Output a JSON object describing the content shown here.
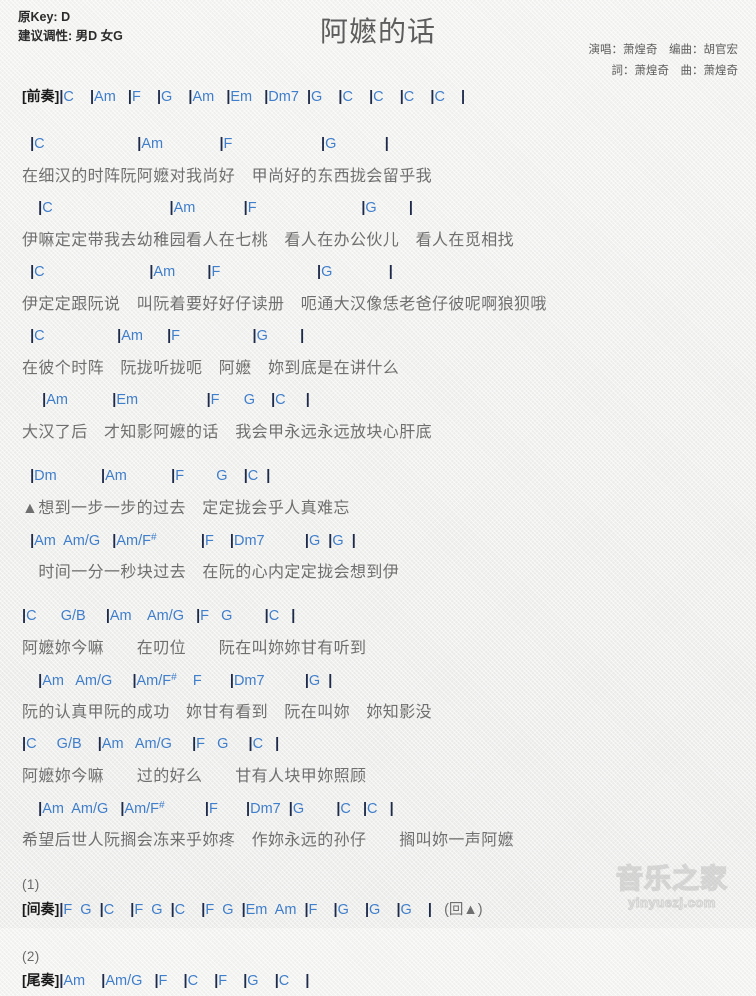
{
  "header": {
    "orig_key": "原Key: D",
    "suggested_key": "建议调性: 男D 女G",
    "title": "阿嬷的话",
    "credit_line_1": "演唱：萧煌奇　编曲：胡官宏",
    "credit_line_2": "詞：萧煌奇　曲：萧煌奇"
  },
  "labels": {
    "intro": "[前奏]",
    "interlude": "[间奏]",
    "outro": "[尾奏]",
    "repeat_mark": "(回▲)",
    "num_1": "(1)",
    "num_2": "(2)",
    "triangle": "▲"
  },
  "intro": {
    "chords": "|C    |Am   |F    |G    |Am   |Em   |Dm7  |G    |C    |C    |C    |C    |"
  },
  "verse1": [
    {
      "chords": "  |C                       |Am              |F                      |G            |",
      "lyrics": "在细汉的时阵阮阿嬷对我尚好　甲尚好的东西拢会留乎我"
    },
    {
      "chords": "    |C                             |Am            |F                          |G        |",
      "lyrics": "伊嘛定定带我去幼稚园看人在七桃　看人在办公伙儿　看人在觅相找"
    },
    {
      "chords": "  |C                          |Am        |F                        |G              |",
      "lyrics": "伊定定跟阮说　叫阮着要好好仔读册　呃通大汉像恁老爸仔彼呢啊狼狈哦"
    },
    {
      "chords": "  |C                  |Am      |F                  |G        |",
      "lyrics": "在彼个时阵　阮拢听拢呃　阿嬷　妳到底是在讲什么"
    },
    {
      "chords": "     |Am           |Em                 |F      G    |C     |",
      "lyrics": "大汉了后　才知影阿嬷的话　我会甲永远永远放块心肝底"
    }
  ],
  "bridge": [
    {
      "chords": "  |Dm           |Am           |F        G    |C  |",
      "lyrics": "▲想到一步一步的过去　定定拢会乎人真难忘"
    },
    {
      "chords": "  |Am  Am/G   |Am/F#           |F    |Dm7          |G  |G  |",
      "lyrics": "　时间一分一秒块过去　在阮的心内定定拢会想到伊"
    }
  ],
  "chorus1": [
    {
      "chords": "|C      G/B     |Am    Am/G   |F   G        |C   |",
      "lyrics": "阿嬷妳今嘛　　在叨位　　阮在叫妳妳甘有听到"
    },
    {
      "chords": "    |Am   Am/G     |Am/F#    F       |Dm7          |G  |",
      "lyrics": "阮的认真甲阮的成功　妳甘有看到　阮在叫妳　妳知影没"
    },
    {
      "chords": "|C     G/B    |Am   Am/G     |F   G     |C   |",
      "lyrics": "阿嬷妳今嘛　　过的好么　　甘有人块甲妳照顾"
    },
    {
      "chords": "    |Am  Am/G   |Am/F#          |F       |Dm7  |G        |C   |C   |",
      "lyrics": "希望后世人阮搁会冻来乎妳疼　作妳永远的孙仔　　搁叫妳一声阿嬷"
    }
  ],
  "interlude": {
    "chords": "|F  G  |C    |F  G  |C    |F  G  |Em  Am  |F    |G    |G    |G    |   "
  },
  "outro": {
    "chords": "|Am    |Am/G   |F    |C    |F    |G    |C    |"
  },
  "watermark": {
    "cn": "音乐之家",
    "en": "yinyuezj.com"
  },
  "colors": {
    "chord": "#3f7ecb",
    "barline": "#1d2a4a",
    "lyric": "#6f6f6f",
    "title": "#5d5d5d",
    "background": "#f2f2f0"
  }
}
